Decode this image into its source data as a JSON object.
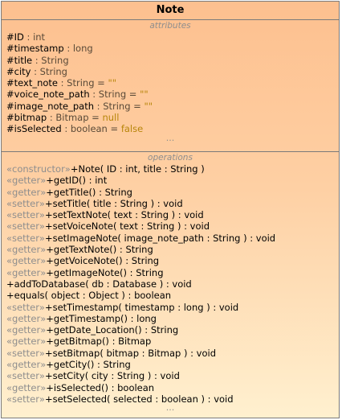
{
  "class_name": "Note",
  "attributes_label": "attributes",
  "operations_label": "operations",
  "ellipsis": "...",
  "attributes": [
    {
      "name": "#ID",
      "type": " : int",
      "default": ""
    },
    {
      "name": "#timestamp",
      "type": " : long",
      "default": ""
    },
    {
      "name": "#title",
      "type": " : String",
      "default": ""
    },
    {
      "name": "#city",
      "type": " : String",
      "default": ""
    },
    {
      "name": "#text_note",
      "type": " : String = ",
      "default": "\"\""
    },
    {
      "name": "#voice_note_path",
      "type": " : String = ",
      "default": "\"\""
    },
    {
      "name": "#image_note_path",
      "type": " : String = ",
      "default": "\"\""
    },
    {
      "name": "#bitmap",
      "type": " : Bitmap = ",
      "default": "null"
    },
    {
      "name": "#isSelected",
      "type": " : boolean = ",
      "default": "false"
    }
  ],
  "operations": [
    {
      "stereotype": "«constructor»",
      "signature": "+Note( ID : int, title : String )"
    },
    {
      "stereotype": "«getter»",
      "signature": "+getID() : int"
    },
    {
      "stereotype": "«getter»",
      "signature": "+getTitle() : String"
    },
    {
      "stereotype": "«setter»",
      "signature": "+setTitle( title : String ) : void"
    },
    {
      "stereotype": "«setter»",
      "signature": "+setTextNote( text : String ) : void"
    },
    {
      "stereotype": "«setter»",
      "signature": "+setVoiceNote( text : String ) : void"
    },
    {
      "stereotype": "«setter»",
      "signature": "+setImageNote( image_note_path : String ) : void"
    },
    {
      "stereotype": "«getter»",
      "signature": "+getTextNote() : String"
    },
    {
      "stereotype": "«getter»",
      "signature": "+getVoiceNote() : String"
    },
    {
      "stereotype": "«getter»",
      "signature": "+getImageNote() : String"
    },
    {
      "stereotype": "",
      "signature": "+addToDatabase( db : Database ) : void"
    },
    {
      "stereotype": "",
      "signature": "+equals( object : Object ) : boolean"
    },
    {
      "stereotype": "«setter»",
      "signature": "+setTimestamp( timestamp : long ) : void"
    },
    {
      "stereotype": "«getter»",
      "signature": "+getTimestamp() : long"
    },
    {
      "stereotype": "«getter»",
      "signature": "+getDate_Location() : String"
    },
    {
      "stereotype": "«getter»",
      "signature": "+getBitmap() : Bitmap"
    },
    {
      "stereotype": "«setter»",
      "signature": "+setBitmap( bitmap : Bitmap ) : void"
    },
    {
      "stereotype": "«getter»",
      "signature": "+getCity() : String"
    },
    {
      "stereotype": "«setter»",
      "signature": "+setCity( city : String ) : void"
    },
    {
      "stereotype": "«getter»",
      "signature": "+isSelected() : boolean"
    },
    {
      "stereotype": "«setter»",
      "signature": "+setSelected( selected : boolean ) : void"
    }
  ]
}
